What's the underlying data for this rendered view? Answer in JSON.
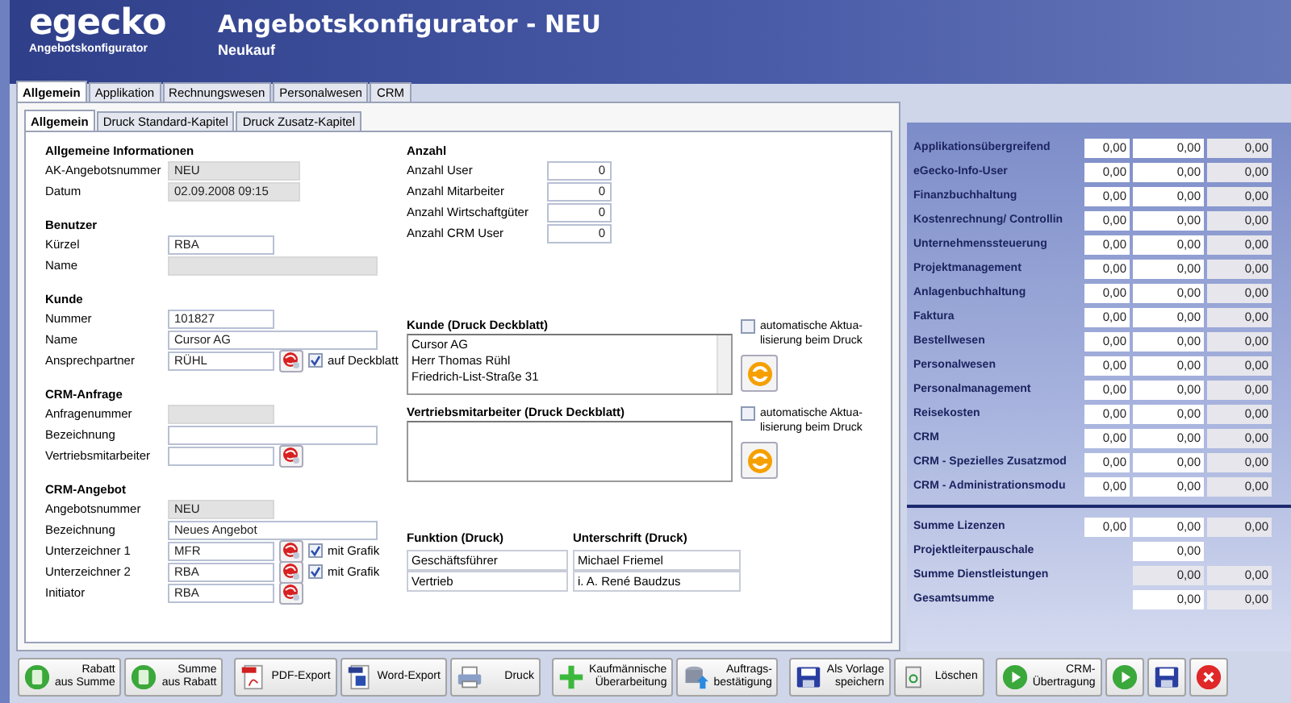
{
  "header": {
    "logo": "egecko",
    "logo_subtitle": "Angebotskonfigurator",
    "title": "Angebotskonfigurator - NEU",
    "subtitle": "Neukauf"
  },
  "tabs": [
    {
      "label": "Allgemein",
      "selected": true
    },
    {
      "label": "Applikation",
      "selected": false
    },
    {
      "label": "Rechnungswesen",
      "selected": false
    },
    {
      "label": "Personalwesen",
      "selected": false
    },
    {
      "label": "CRM",
      "selected": false
    }
  ],
  "subtabs": [
    {
      "label": "Allgemein",
      "selected": true
    },
    {
      "label": "Druck Standard-Kapitel",
      "selected": false
    },
    {
      "label": "Druck Zusatz-Kapitel",
      "selected": false
    }
  ],
  "left_sections": [
    {
      "title": "Allgemeine Informationen",
      "rows": [
        {
          "label": "AK-Angebotsnummer",
          "value": "NEU",
          "kind": "medium",
          "disabled": true
        },
        {
          "label": "Datum",
          "value": "02.09.2008 09:15",
          "kind": "medium",
          "disabled": true
        }
      ]
    },
    {
      "title": "Benutzer",
      "rows": [
        {
          "label": "Kürzel",
          "value": "RBA",
          "kind": "short",
          "disabled": false
        },
        {
          "label": "Name",
          "kind": "long",
          "disabled": true
        }
      ]
    },
    {
      "title": "Kunde",
      "rows": [
        {
          "label": "Nummer",
          "value": "101827",
          "kind": "short",
          "disabled": false
        },
        {
          "label": "Name",
          "value": "Cursor AG",
          "kind": "long",
          "disabled": false
        },
        {
          "label": "Ansprechpartner",
          "value": "RÜHL",
          "kind": "short",
          "disabled": false,
          "pick": true,
          "checkbox": {
            "label": "auf Deckblatt",
            "checked": true
          }
        }
      ]
    },
    {
      "title": "CRM-Anfrage",
      "rows": [
        {
          "label": "Anfragenummer",
          "kind": "short",
          "disabled": true
        },
        {
          "label": "Bezeichnung",
          "kind": "long",
          "disabled": false
        },
        {
          "label": "Vertriebsmitarbeiter",
          "kind": "short",
          "disabled": false,
          "pick": true
        }
      ]
    },
    {
      "title": "CRM-Angebot",
      "rows": [
        {
          "label": "Angebotsnummer",
          "value": "NEU",
          "kind": "short",
          "disabled": true
        },
        {
          "label": "Bezeichnung",
          "value": "Neues Angebot",
          "kind": "long",
          "disabled": false
        },
        {
          "label": "Unterzeichner 1",
          "value": "MFR",
          "kind": "short",
          "disabled": false,
          "pick": true,
          "checkbox": {
            "label": "mit Grafik",
            "checked": true
          }
        },
        {
          "label": "Unterzeichner 2",
          "value": "RBA",
          "kind": "short",
          "disabled": false,
          "pick": true,
          "checkbox": {
            "label": "mit Grafik",
            "checked": true
          }
        },
        {
          "label": "Initiator",
          "value": "RBA",
          "kind": "short",
          "disabled": false,
          "pick": true
        }
      ]
    }
  ],
  "anzahl": {
    "title": "Anzahl",
    "rows": [
      {
        "label": "Anzahl User",
        "value": "0"
      },
      {
        "label": "Anzahl Mitarbeiter",
        "value": "0"
      },
      {
        "label": "Anzahl Wirtschaftgüter",
        "value": "0"
      },
      {
        "label": "Anzahl CRM User",
        "value": "0"
      }
    ]
  },
  "print_blocks": [
    {
      "title": "Kunde (Druck Deckblatt)",
      "lines": [
        "Cursor AG",
        "Herr Thomas Rühl",
        "Friedrich-List-Straße 31"
      ],
      "scrollbar": true,
      "checkbox": {
        "label_lines": [
          "automatische Aktua-",
          "lisierung beim Druck"
        ],
        "checked": false
      }
    },
    {
      "title": "Vertriebsmitarbeiter (Druck Deckblatt)",
      "scrollbar": false,
      "checkbox": {
        "label_lines": [
          "automatische Aktua-",
          "lisierung beim Druck"
        ],
        "checked": false
      }
    }
  ],
  "signature_table": {
    "columns": [
      "Funktion (Druck)",
      "Unterschrift (Druck)"
    ],
    "rows": [
      [
        "Geschäftsführer",
        "Michael Friemel"
      ],
      [
        "Vertrieb",
        "i. A. René Baudzus"
      ]
    ]
  },
  "price_rows": [
    {
      "label": "Applikationsübergreifend",
      "cells": [
        {
          "value": "0,00",
          "disabled": false
        },
        {
          "value": "0,00",
          "disabled": false
        },
        {
          "value": "0,00",
          "disabled": true
        }
      ]
    },
    {
      "label": "eGecko-Info-User",
      "cells": [
        {
          "value": "0,00",
          "disabled": false
        },
        {
          "value": "0,00",
          "disabled": false
        },
        {
          "value": "0,00",
          "disabled": true
        }
      ]
    },
    {
      "label": "Finanzbuchhaltung",
      "cells": [
        {
          "value": "0,00",
          "disabled": false
        },
        {
          "value": "0,00",
          "disabled": false
        },
        {
          "value": "0,00",
          "disabled": true
        }
      ]
    },
    {
      "label": "Kostenrechnung/ Controllin",
      "cells": [
        {
          "value": "0,00",
          "disabled": false
        },
        {
          "value": "0,00",
          "disabled": false
        },
        {
          "value": "0,00",
          "disabled": true
        }
      ]
    },
    {
      "label": "Unternehmenssteuerung",
      "cells": [
        {
          "value": "0,00",
          "disabled": false
        },
        {
          "value": "0,00",
          "disabled": false
        },
        {
          "value": "0,00",
          "disabled": true
        }
      ]
    },
    {
      "label": "Projektmanagement",
      "cells": [
        {
          "value": "0,00",
          "disabled": false
        },
        {
          "value": "0,00",
          "disabled": false
        },
        {
          "value": "0,00",
          "disabled": true
        }
      ]
    },
    {
      "label": "Anlagenbuchhaltung",
      "cells": [
        {
          "value": "0,00",
          "disabled": false
        },
        {
          "value": "0,00",
          "disabled": false
        },
        {
          "value": "0,00",
          "disabled": true
        }
      ]
    },
    {
      "label": "Faktura",
      "cells": [
        {
          "value": "0,00",
          "disabled": false
        },
        {
          "value": "0,00",
          "disabled": false
        },
        {
          "value": "0,00",
          "disabled": true
        }
      ]
    },
    {
      "label": "Bestellwesen",
      "cells": [
        {
          "value": "0,00",
          "disabled": false
        },
        {
          "value": "0,00",
          "disabled": false
        },
        {
          "value": "0,00",
          "disabled": true
        }
      ]
    },
    {
      "label": "Personalwesen",
      "cells": [
        {
          "value": "0,00",
          "disabled": false
        },
        {
          "value": "0,00",
          "disabled": false
        },
        {
          "value": "0,00",
          "disabled": true
        }
      ]
    },
    {
      "label": "Personalmanagement",
      "cells": [
        {
          "value": "0,00",
          "disabled": false
        },
        {
          "value": "0,00",
          "disabled": false
        },
        {
          "value": "0,00",
          "disabled": true
        }
      ]
    },
    {
      "label": "Reisekosten",
      "cells": [
        {
          "value": "0,00",
          "disabled": false
        },
        {
          "value": "0,00",
          "disabled": false
        },
        {
          "value": "0,00",
          "disabled": true
        }
      ]
    },
    {
      "label": "CRM",
      "cells": [
        {
          "value": "0,00",
          "disabled": false
        },
        {
          "value": "0,00",
          "disabled": false
        },
        {
          "value": "0,00",
          "disabled": true
        }
      ]
    },
    {
      "label": "CRM - Spezielles Zusatzmod",
      "cells": [
        {
          "value": "0,00",
          "disabled": false
        },
        {
          "value": "0,00",
          "disabled": false
        },
        {
          "value": "0,00",
          "disabled": true
        }
      ]
    },
    {
      "label": "CRM - Administrationsmodu",
      "cells": [
        {
          "value": "0,00",
          "disabled": false
        },
        {
          "value": "0,00",
          "disabled": false
        },
        {
          "value": "0,00",
          "disabled": true
        }
      ]
    }
  ],
  "summary_rows": [
    {
      "label": "Summe Lizenzen",
      "cells": [
        {
          "kind": "field",
          "value": "0,00",
          "disabled": false
        },
        {
          "kind": "field",
          "value": "0,00",
          "disabled": false
        },
        {
          "kind": "field",
          "value": "0,00",
          "disabled": true
        }
      ]
    },
    {
      "label": "Projektleiterpauschale",
      "cells": [
        {
          "kind": "blank"
        },
        {
          "kind": "field",
          "value": "0,00",
          "disabled": false
        },
        {
          "kind": "blank"
        }
      ]
    },
    {
      "label": "Summe Dienstleistungen",
      "cells": [
        {
          "kind": "blank"
        },
        {
          "kind": "field",
          "value": "0,00",
          "disabled": true
        },
        {
          "kind": "field",
          "value": "0,00",
          "disabled": true
        }
      ]
    },
    {
      "label": "Gesamtsumme",
      "cells": [
        {
          "kind": "blank"
        },
        {
          "kind": "field",
          "value": "0,00",
          "disabled": false
        },
        {
          "kind": "field",
          "value": "0,00",
          "disabled": true
        }
      ]
    }
  ],
  "toolbar_groups": [
    [
      {
        "kind": "text",
        "lines": [
          "Rabatt",
          "aus Summe"
        ]
      },
      {
        "kind": "text",
        "lines": [
          "Summe",
          "aus Rabatt"
        ]
      }
    ],
    [
      {
        "kind": "text",
        "lines": [
          "PDF-Export"
        ]
      },
      {
        "kind": "text",
        "lines": [
          "Word-Export"
        ]
      },
      {
        "kind": "text",
        "lines": [
          "Druck"
        ]
      }
    ],
    [
      {
        "kind": "text",
        "lines": [
          "Kaufmännische",
          "Überarbeitung"
        ]
      },
      {
        "kind": "text",
        "lines": [
          "Auftrags-",
          "bestätigung"
        ]
      }
    ],
    [
      {
        "kind": "text",
        "lines": [
          "Als Vorlage",
          "speichern"
        ]
      },
      {
        "kind": "text",
        "lines": [
          "Löschen"
        ]
      }
    ],
    [
      {
        "kind": "text",
        "lines": [
          "CRM-",
          "Übertragung"
        ]
      },
      {
        "kind": "icon"
      },
      {
        "kind": "icon"
      },
      {
        "kind": "icon"
      }
    ]
  ]
}
